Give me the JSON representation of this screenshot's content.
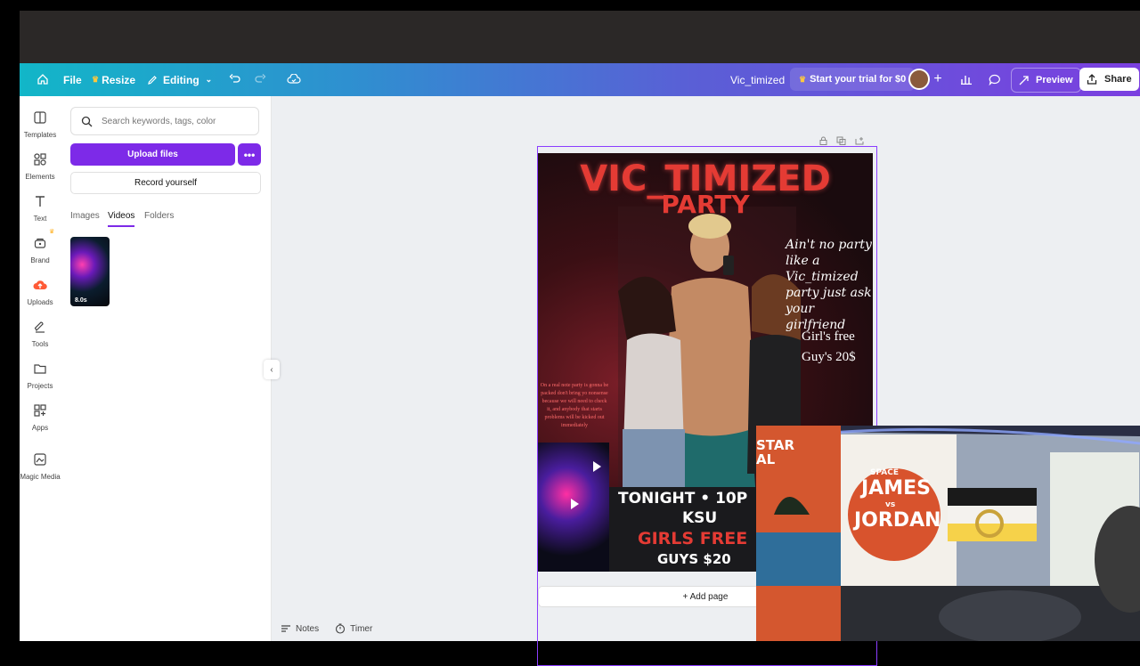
{
  "topbar": {
    "file_label": "File",
    "resize_label": "Resize",
    "editing_label": "Editing",
    "doc_title": "Vic_timized",
    "trial_label": "Start your trial for $0",
    "preview_label": "Preview",
    "share_label": "Share"
  },
  "rail": {
    "items": [
      {
        "label": "Templates",
        "icon": "templates-icon"
      },
      {
        "label": "Elements",
        "icon": "elements-icon"
      },
      {
        "label": "Text",
        "icon": "text-icon"
      },
      {
        "label": "Brand",
        "icon": "brand-icon"
      },
      {
        "label": "Uploads",
        "icon": "uploads-icon"
      },
      {
        "label": "Tools",
        "icon": "tools-icon"
      },
      {
        "label": "Projects",
        "icon": "projects-icon"
      },
      {
        "label": "Apps",
        "icon": "apps-icon"
      },
      {
        "label": "Magic Media",
        "icon": "magic-media-icon"
      }
    ]
  },
  "panel": {
    "search_placeholder": "Search keywords, tags, color",
    "upload_label": "Upload files",
    "more_label": "•••",
    "record_label": "Record yourself",
    "tabs": [
      "Images",
      "Videos",
      "Folders"
    ],
    "active_tab": "Videos",
    "thumb_duration": "8.0s"
  },
  "poster": {
    "title": "VIC_TIMIZED",
    "subtitle": "PARTY",
    "tagline": "Ain't no party like a Vic_timized party just ask your girlfriend",
    "price_girls": "Girl's free",
    "price_guys": "Guy's 20$",
    "small_text": "On a real note party is gonna be packed don't bring yo nonsense because we will need to check it, and anybody that starts problems will be kicked out immediately",
    "line_tonight": "TONIGHT • 10P",
    "line_location": "KSU",
    "line_girls": "GIRLS FREE",
    "line_guys": "GUYS $20"
  },
  "canvas": {
    "add_page_label": "+ Add page",
    "notes_label": "Notes",
    "timer_label": "Timer"
  },
  "webcam": {
    "banner_line1": "SPACE",
    "banner_line2": "JAMES",
    "banner_line3": "vs",
    "banner_line4": "JORDAN",
    "left_banner": "STAR\nAL"
  },
  "colors": {
    "accent_purple": "#7d2ae8",
    "poster_red": "#e43b34"
  }
}
